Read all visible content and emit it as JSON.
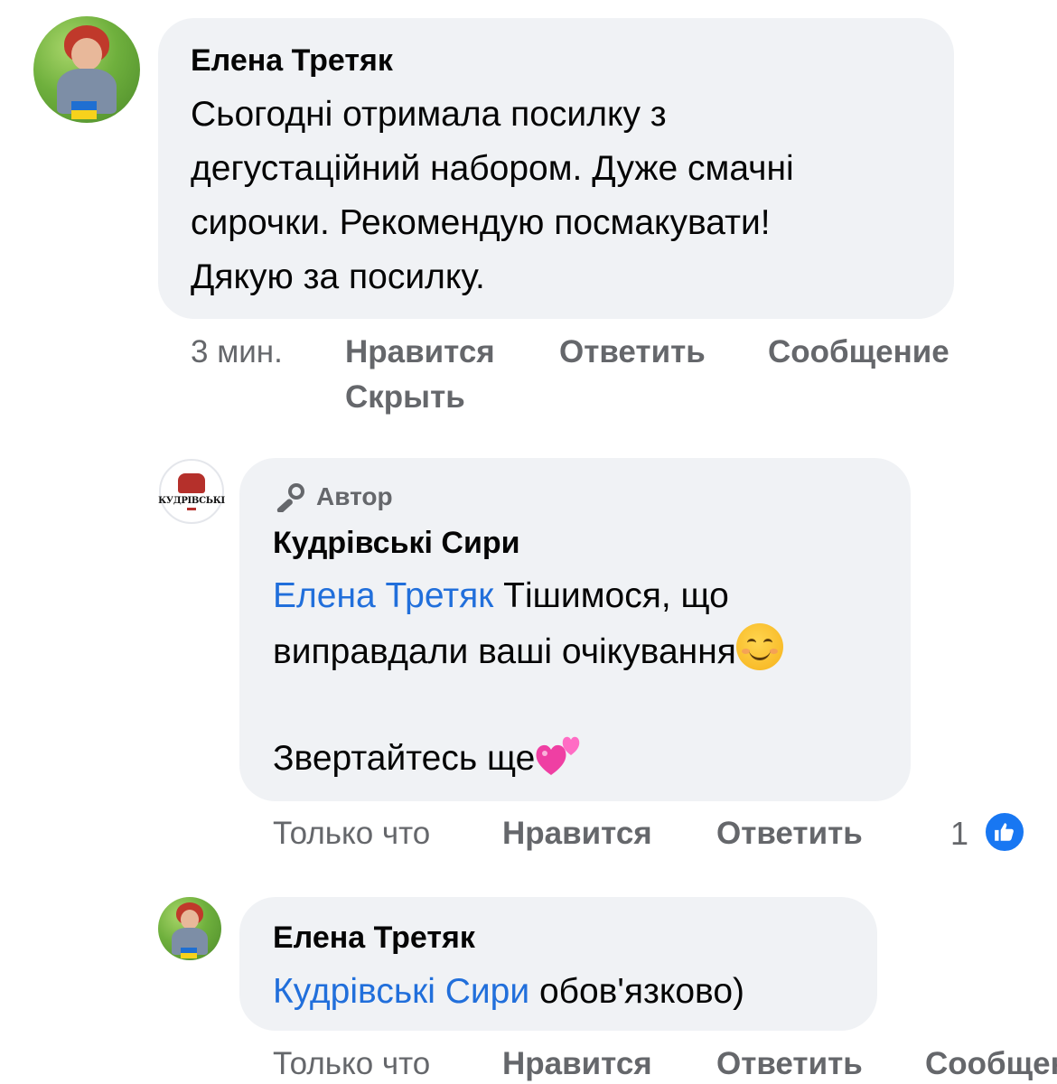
{
  "comments": [
    {
      "author": "Елена Третяк",
      "lines": [
        "Сьогодні отримала посилку з",
        "дегустаційний набором. Дуже смачні",
        "сирочки. Рекомендую посмакувати!",
        "Дякую за посилку."
      ],
      "time": "3 мин.",
      "actions": [
        "Нравится",
        "Ответить",
        "Сообщение",
        "Скрыть"
      ]
    },
    {
      "badge": "Автор",
      "author": "Кудрівські Сири",
      "logo_text": "КУДРІВСЬКІ",
      "mention": "Елена Третяк",
      "line1_rest": " Тішимося, що",
      "line2": "виправдали ваші очікування",
      "line3": "Звертайтесь ще",
      "time": "Только что",
      "actions": [
        "Нравится",
        "Ответить"
      ],
      "like_count": "1"
    },
    {
      "author": "Елена Третяк",
      "mention": "Кудрівські Сири",
      "rest": " обов'язково)",
      "time": "Только что",
      "actions": [
        "Нравится",
        "Ответить",
        "Сообщение"
      ]
    }
  ],
  "colors": {
    "bubble": "#f0f2f5",
    "mention": "#216fdb",
    "meta": "#65676b",
    "like": "#1877f2"
  },
  "icons": [
    "mic-icon",
    "like-icon",
    "smile-emoji",
    "two-hearts-emoji"
  ]
}
